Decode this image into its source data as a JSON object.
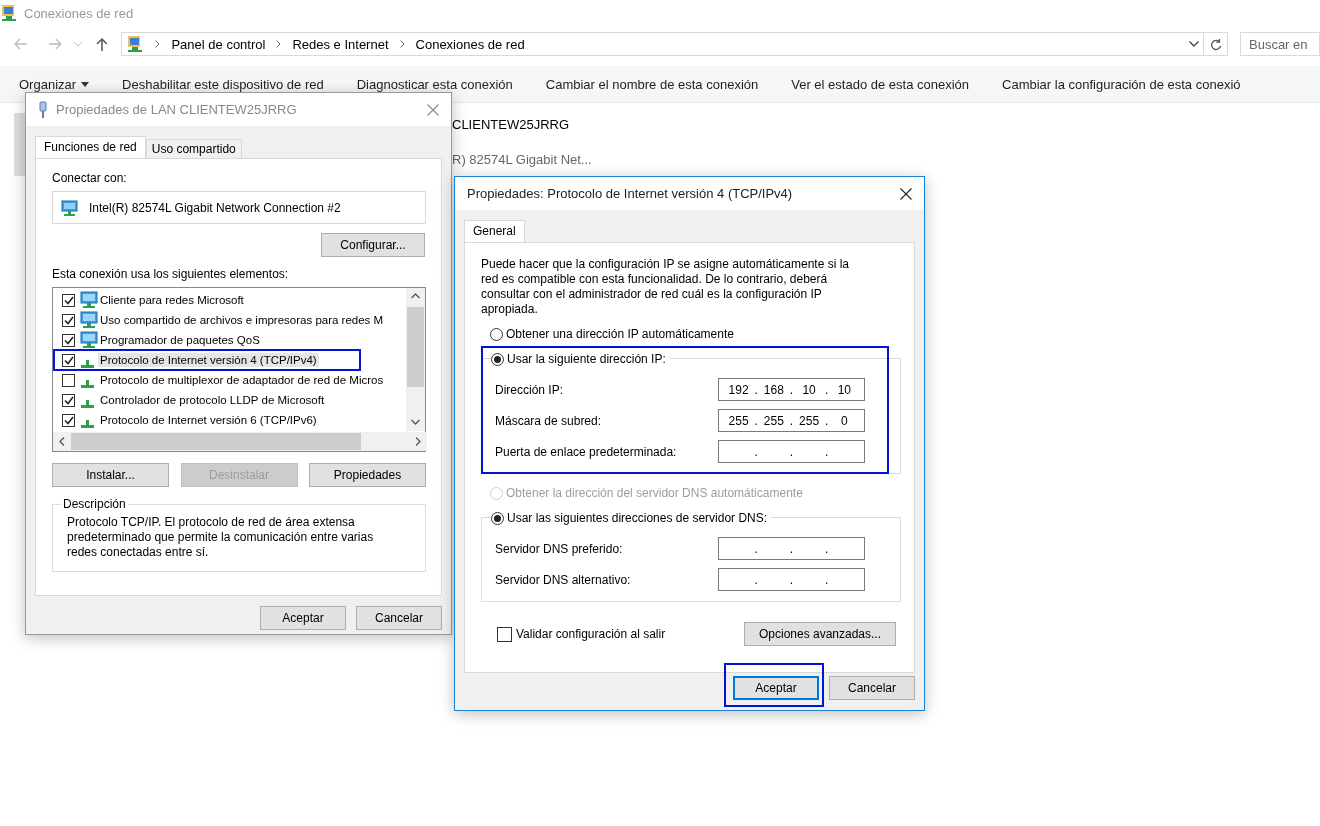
{
  "explorer": {
    "title": "Conexiones de red",
    "breadcrumb": [
      "Panel de control",
      "Redes e Internet",
      "Conexiones de red"
    ],
    "search": {
      "placeholder": "Buscar en"
    },
    "toolbar": [
      {
        "label": "Organizar",
        "dropdown": true
      },
      {
        "label": "Deshabilitar este dispositivo de red",
        "dropdown": false
      },
      {
        "label": "Diagnosticar esta conexión",
        "dropdown": false
      },
      {
        "label": "Cambiar el nombre de esta conexión",
        "dropdown": false
      },
      {
        "label": "Ver el estado de esta conexión",
        "dropdown": false
      },
      {
        "label": "Cambiar la configuración de esta conexió",
        "dropdown": false
      }
    ],
    "background_items": [
      "CLIENTEW25JRRG",
      "R) 82574L Gigabit Net..."
    ]
  },
  "lan_dialog": {
    "title": "Propiedades de LAN CLIENTEW25JRRG",
    "tabs": [
      {
        "label": "Funciones de red",
        "selected": true
      },
      {
        "label": "Uso compartido",
        "selected": false
      }
    ],
    "connect_label": "Conectar con:",
    "adapter": "Intel(R) 82574L Gigabit Network Connection #2",
    "configure_button": "Configurar...",
    "elements_label": "Esta conexión usa los siguientes elementos:",
    "elements": [
      {
        "label": "Cliente para redes Microsoft",
        "kind": "service",
        "checked": true,
        "selected": false,
        "annotated": false
      },
      {
        "label": "Uso compartido de archivos e impresoras para redes M",
        "kind": "service",
        "checked": true,
        "selected": false,
        "annotated": false
      },
      {
        "label": "Programador de paquetes QoS",
        "kind": "service",
        "checked": true,
        "selected": false,
        "annotated": false
      },
      {
        "label": "Protocolo de Internet versión 4 (TCP/IPv4)",
        "kind": "protocol",
        "checked": true,
        "selected": true,
        "annotated": true
      },
      {
        "label": "Protocolo de multiplexor de adaptador de red de Micros",
        "kind": "protocol",
        "checked": false,
        "selected": false,
        "annotated": false
      },
      {
        "label": "Controlador de protocolo LLDP de Microsoft",
        "kind": "protocol",
        "checked": true,
        "selected": false,
        "annotated": false
      },
      {
        "label": "Protocolo de Internet versión 6 (TCP/IPv6)",
        "kind": "protocol",
        "checked": true,
        "selected": false,
        "annotated": false
      }
    ],
    "buttons": [
      {
        "label": "Instalar...",
        "disabled": false
      },
      {
        "label": "Desinstalar",
        "disabled": true
      },
      {
        "label": "Propiedades",
        "disabled": false
      }
    ],
    "description": {
      "legend": "Descripción",
      "text": "Protocolo TCP/IP. El protocolo de red de área extensa predeterminado que permite la comunicación entre varias redes conectadas entre sí."
    },
    "footer": [
      "Aceptar",
      "Cancelar"
    ]
  },
  "ipv4_dialog": {
    "title": "Propiedades: Protocolo de Internet versión 4 (TCP/IPv4)",
    "tabs": [
      {
        "label": "General",
        "selected": true
      }
    ],
    "intro": "Puede hacer que la configuración IP se asigne automáticamente si la red es compatible con esta funcionalidad. De lo contrario, deberá consultar con el administrador de red cuál es la configuración IP apropiada.",
    "ip": {
      "auto_option": {
        "label": "Obtener una dirección IP automáticamente",
        "selected": false,
        "disabled": false
      },
      "manual_option": {
        "label": "Usar la siguiente dirección IP:",
        "selected": true,
        "disabled": false
      },
      "annotated": true,
      "fields": [
        {
          "label": "Dirección IP:",
          "octets": [
            "192",
            "168",
            "10",
            "10"
          ],
          "dots": [
            ".",
            ".",
            "."
          ]
        },
        {
          "label": "Máscara de subred:",
          "octets": [
            "255",
            "255",
            "255",
            "0"
          ],
          "dots": [
            ".",
            ".",
            "."
          ]
        },
        {
          "label": "Puerta de enlace predeterminada:",
          "dots": [
            ".",
            ".",
            "."
          ]
        }
      ]
    },
    "dns": {
      "auto_option": {
        "label": "Obtener la dirección del servidor DNS automáticamente",
        "selected": false,
        "disabled": true
      },
      "manual_option": {
        "label": "Usar las siguientes direcciones de servidor DNS:",
        "selected": true,
        "disabled": false
      },
      "annotated": false,
      "fields": [
        {
          "label": "Servidor DNS preferido:",
          "dots": [
            ".",
            ".",
            "."
          ]
        },
        {
          "label": "Servidor DNS alternativo:",
          "dots": [
            ".",
            ".",
            "."
          ]
        }
      ]
    },
    "validate": {
      "label": "Validar configuración al salir",
      "checked": false
    },
    "advanced_button": "Opciones avanzadas...",
    "footer": [
      {
        "label": "Aceptar",
        "default": true,
        "annotated": true
      },
      {
        "label": "Cancelar",
        "default": false,
        "annotated": false
      }
    ]
  }
}
